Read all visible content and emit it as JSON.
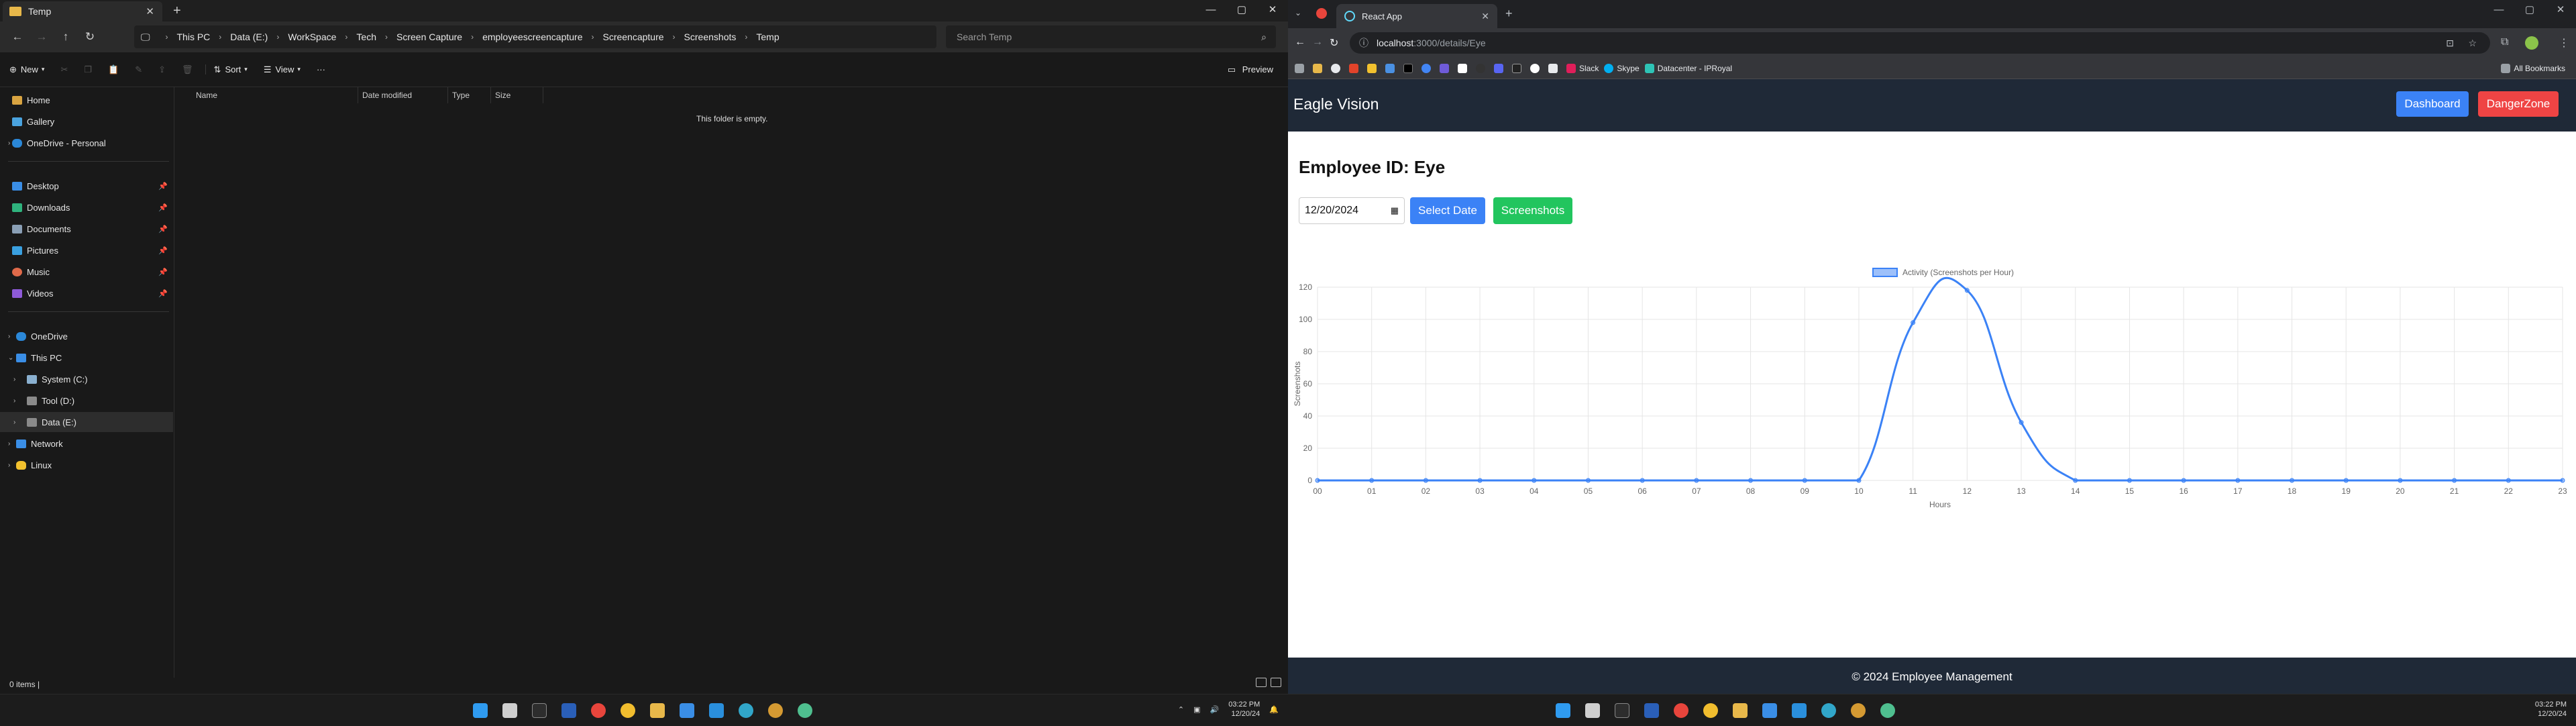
{
  "explorer": {
    "tab_title": "Temp",
    "breadcrumbs": [
      "This PC",
      "Data (E:)",
      "WorkSpace",
      "Tech",
      "Screen Capture",
      "employeescreencapture",
      "Screencapture",
      "Screenshots",
      "Temp"
    ],
    "search_placeholder": "Search Temp",
    "commands": {
      "new": "New",
      "sort": "Sort",
      "view": "View",
      "more": "···",
      "preview": "Preview"
    },
    "columns": [
      "Name",
      "Date modified",
      "Type",
      "Size"
    ],
    "empty_message": "This folder is empty.",
    "status": "0 items  |",
    "nav": {
      "home": "Home",
      "gallery": "Gallery",
      "onedrive_personal": "OneDrive - Personal",
      "desktop": "Desktop",
      "downloads": "Downloads",
      "documents": "Documents",
      "pictures": "Pictures",
      "music": "Music",
      "videos": "Videos",
      "onedrive": "OneDrive",
      "this_pc": "This PC",
      "system_c": "System (C:)",
      "tool_d": "Tool (D:)",
      "data_e": "Data (E:)",
      "network": "Network",
      "linux": "Linux"
    },
    "clock": {
      "time": "03:22 PM",
      "date": "12/20/24"
    }
  },
  "browser": {
    "tab_title": "React App",
    "url_host": "localhost",
    "url_path": ":3000/details/Eye",
    "bookmarks": [
      "Slack",
      "Skype",
      "Datacenter - IPRoyal"
    ],
    "all_bookmarks": "All Bookmarks",
    "clock": {
      "time": "03:22 PM",
      "date": "12/20/24"
    }
  },
  "app": {
    "brand": "Eagle Vision",
    "dashboard_label": "Dashboard",
    "dangerzone_label": "DangerZone",
    "employee_heading": "Employee ID: Eye",
    "date_value": "12/20/2024",
    "select_date_label": "Select Date",
    "screenshots_label": "Screenshots",
    "footer": "© 2024 Employee Management"
  },
  "colors": {
    "blue": "#3b82f6",
    "red": "#ef4444",
    "green": "#22c55e",
    "navy": "#1f2937"
  },
  "chart_data": {
    "type": "line",
    "legend": "Activity (Screenshots per Hour)",
    "legend_position": "top",
    "xlabel": "Hours",
    "ylabel": "Screenshots",
    "categories": [
      "00",
      "01",
      "02",
      "03",
      "04",
      "05",
      "06",
      "07",
      "08",
      "09",
      "10",
      "11",
      "12",
      "13",
      "14",
      "15",
      "16",
      "17",
      "18",
      "19",
      "20",
      "21",
      "22",
      "23"
    ],
    "values": [
      0,
      0,
      0,
      0,
      0,
      0,
      0,
      0,
      0,
      0,
      0,
      98,
      118,
      36,
      0,
      0,
      0,
      0,
      0,
      0,
      0,
      0,
      0,
      0
    ],
    "ylim": [
      0,
      120
    ],
    "yticks": [
      0,
      20,
      40,
      60,
      80,
      100,
      120
    ],
    "grid": true,
    "line_color": "#3b82f6"
  }
}
